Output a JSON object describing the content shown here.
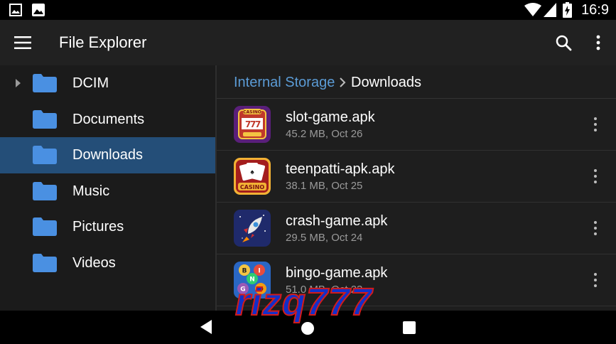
{
  "status_bar": {
    "time": "16:9",
    "icons": [
      "image-notification-icon",
      "photo-notification-icon",
      "wifi-icon",
      "cell-signal-icon",
      "battery-charging-icon"
    ]
  },
  "app_bar": {
    "title": "File Explorer",
    "icons": [
      "menu-icon",
      "search-icon",
      "more-vert-icon"
    ]
  },
  "sidebar": {
    "items": [
      {
        "label": "DCIM",
        "selected": false,
        "expandable": true
      },
      {
        "label": "Documents",
        "selected": false,
        "expandable": false
      },
      {
        "label": "Downloads",
        "selected": true,
        "expandable": false
      },
      {
        "label": "Music",
        "selected": false,
        "expandable": false
      },
      {
        "label": "Pictures",
        "selected": false,
        "expandable": false
      },
      {
        "label": "Videos",
        "selected": false,
        "expandable": false
      }
    ]
  },
  "breadcrumb": {
    "root": "Internal Storage",
    "current": "Downloads"
  },
  "files": [
    {
      "name": "slot-game.apk",
      "meta": "45.2 MB, Oct 26",
      "icon": "slot-machine-icon",
      "icon_text": "CASINO"
    },
    {
      "name": "teenpatti-apk.apk",
      "meta": "38.1 MB, Oct 25",
      "icon": "playing-cards-icon",
      "icon_text": "CASINO"
    },
    {
      "name": "crash-game.apk",
      "meta": "29.5 MB, Oct 24",
      "icon": "rocket-icon"
    },
    {
      "name": "bingo-game.apk",
      "meta": "51.0 MB, Oct 23",
      "icon": "bingo-balls-icon",
      "icon_letters": [
        "B",
        "I",
        "N",
        "G",
        "O"
      ]
    }
  ],
  "watermark": {
    "text": "rizq777"
  },
  "colors": {
    "accent": "#5b9bd5",
    "selected_bg": "#244e78",
    "folder": "#4a90e2",
    "watermark_fill": "#1330c8",
    "watermark_stroke": "#d21b1b"
  }
}
